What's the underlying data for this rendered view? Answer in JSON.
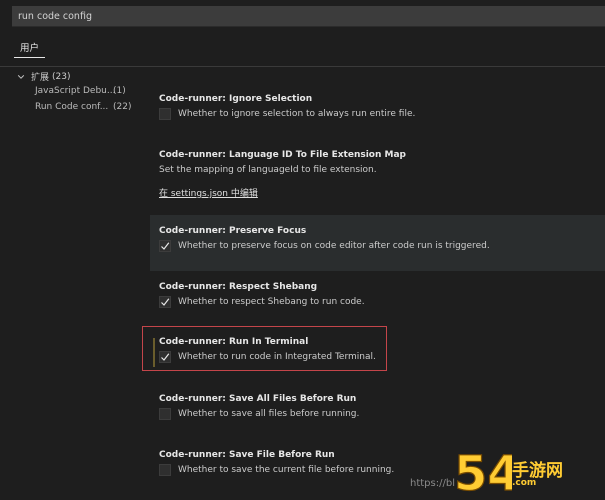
{
  "search": {
    "value": "run code config"
  },
  "tabs": [
    {
      "label": "用户"
    }
  ],
  "toc": {
    "group": {
      "label": "扩展",
      "count": "(23)"
    },
    "items": [
      {
        "label": "JavaScript Debu...",
        "count": "(1)"
      },
      {
        "label": "Run Code conf...",
        "count": "(22)"
      }
    ]
  },
  "settings": [
    {
      "title": "Code-runner: Ignore Selection",
      "description": "Whether to ignore selection to always run entire file.",
      "checked": false
    },
    {
      "title": "Code-runner: Language ID To File Extension Map",
      "description": "Set the mapping of languageId to file extension.",
      "link": "在 settings.json 中编辑"
    },
    {
      "title": "Code-runner: Preserve Focus",
      "description": "Whether to preserve focus on code editor after code run is triggered.",
      "checked": true
    },
    {
      "title": "Code-runner: Respect Shebang",
      "description": "Whether to respect Shebang to run code.",
      "checked": true
    },
    {
      "title": "Code-runner: Run In Terminal",
      "description": "Whether to run code in Integrated Terminal.",
      "checked": true
    },
    {
      "title": "Code-runner: Save All Files Before Run",
      "description": "Whether to save all files before running.",
      "checked": false
    },
    {
      "title": "Code-runner: Save File Before Run",
      "description": "Whether to save the current file before running.",
      "checked": false
    }
  ],
  "watermark": {
    "url": "https://bl",
    "logo_digits": "54",
    "logo_text": "手游网",
    "logo_site": ".com"
  },
  "colors": {
    "background": "#1e1e1e",
    "focus_border": "#c4454a",
    "hover_row": "#2a2d2e",
    "logo_yellow": "#ffcc33"
  }
}
